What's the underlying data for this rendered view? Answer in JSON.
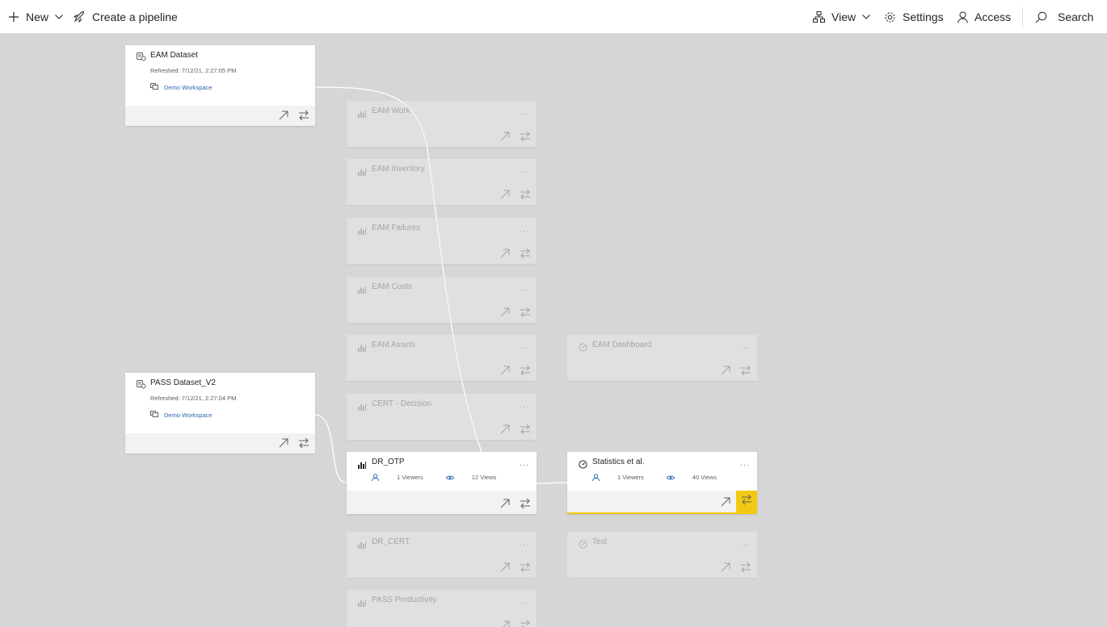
{
  "toolbar": {
    "new_label": "New",
    "create_pipeline_label": "Create a pipeline",
    "view_label": "View",
    "settings_label": "Settings",
    "access_label": "Access",
    "search_label": "Search"
  },
  "colors": {
    "dataset_accent": "#d85c1e",
    "report_accent": "#0c2f91",
    "dashboard_accent": "#0e7a7a",
    "faded_report_accent": "#5b5fc7",
    "faded_dashboard_accent": "#7fb0b0",
    "highlight": "#f2c811"
  },
  "datasets": [
    {
      "title": "EAM Dataset",
      "refreshed": "Refreshed: 7/12/21, 2:27:05 PM",
      "workspace": "Demo Workspace"
    },
    {
      "title": "PASS Dataset_V2",
      "refreshed": "Refreshed: 7/12/21, 2:27:04 PM",
      "workspace": "Demo Workspace"
    }
  ],
  "reports": [
    {
      "title": "EAM Work"
    },
    {
      "title": "EAM Inventory"
    },
    {
      "title": "EAM Failures"
    },
    {
      "title": "EAM Costs"
    },
    {
      "title": "EAM Assets"
    },
    {
      "title": "CERT - Decision"
    },
    {
      "title": "DR_OTP",
      "viewers": "1 Viewers",
      "views": "12 Views"
    },
    {
      "title": "DR_CERT"
    },
    {
      "title": "PASS Productivity"
    }
  ],
  "dashboards": [
    {
      "title": "EAM Dashboard"
    },
    {
      "title": "Statistics et al.",
      "viewers": "1 Viewers",
      "views": "40 Views"
    },
    {
      "title": "Test"
    }
  ],
  "more_glyph": "..."
}
